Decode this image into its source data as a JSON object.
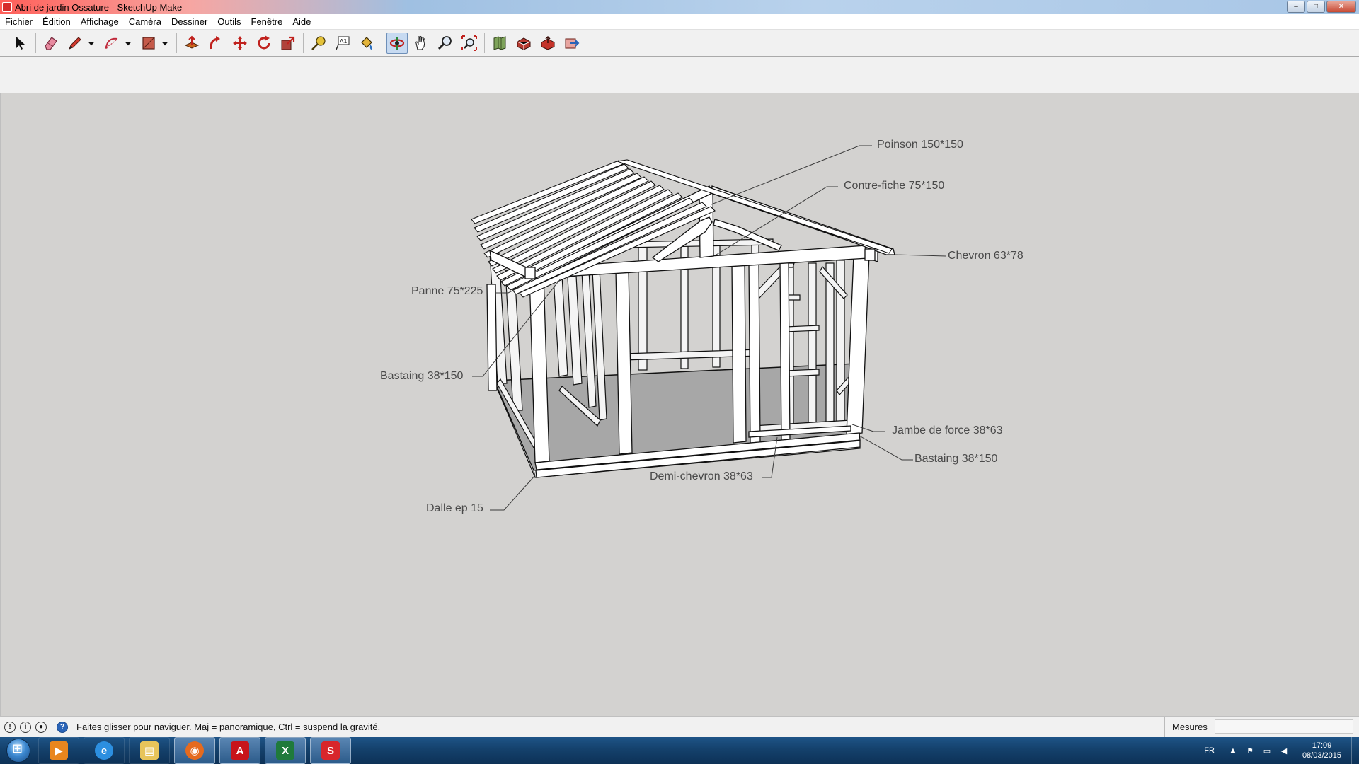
{
  "window": {
    "title": "Abri de jardin Ossature - SketchUp Make",
    "controls": {
      "minimize": "–",
      "maximize": "□",
      "close": "✕"
    }
  },
  "menu": [
    "Fichier",
    "Édition",
    "Affichage",
    "Caméra",
    "Dessiner",
    "Outils",
    "Fenêtre",
    "Aide"
  ],
  "toolbar": {
    "tools": [
      {
        "icon": "select-arrow-icon"
      },
      {
        "icon": "eraser-icon"
      },
      {
        "icon": "pencil-line-icon"
      },
      {
        "icon": "arc-icon"
      },
      {
        "icon": "rectangle-icon"
      },
      {
        "icon": "push-pull-icon"
      },
      {
        "icon": "follow-me-icon"
      },
      {
        "icon": "move-icon"
      },
      {
        "icon": "rotate-icon"
      },
      {
        "icon": "scale-icon"
      },
      {
        "icon": "tape-measure-icon"
      },
      {
        "icon": "text-icon"
      },
      {
        "icon": "paint-bucket-icon"
      },
      {
        "icon": "orbit-icon",
        "active": true
      },
      {
        "icon": "pan-icon"
      },
      {
        "icon": "zoom-icon"
      },
      {
        "icon": "zoom-extents-icon"
      },
      {
        "icon": "add-location-icon"
      },
      {
        "icon": "3d-warehouse-icon"
      },
      {
        "icon": "share-model-icon"
      },
      {
        "icon": "extension-warehouse-icon"
      }
    ]
  },
  "viewport": {
    "labels": {
      "poinson": "Poinson 150*150",
      "contre_fiche": "Contre-fiche 75*150",
      "chevron": "Chevron 63*78",
      "panne": "Panne 75*225",
      "bastaing_left": "Bastaing 38*150",
      "jambe_de_force": "Jambe de force 38*63",
      "bastaing_right": "Bastaing 38*150",
      "demi_chevron": "Demi-chevron 38*63",
      "dalle": "Dalle ep 15"
    }
  },
  "statusbar": {
    "hint": "Faites glisser pour naviguer. Maj = panoramique, Ctrl =  suspend la gravité.",
    "measure_label": "Mesures",
    "measure_value": ""
  },
  "taskbar": {
    "apps": [
      {
        "icon": "media-player-icon",
        "color": "#e8861e"
      },
      {
        "icon": "internet-explorer-icon",
        "color": "#2c8fe0"
      },
      {
        "icon": "file-explorer-icon",
        "color": "#e7c45a"
      },
      {
        "icon": "firefox-icon",
        "color": "#e56a1e"
      },
      {
        "icon": "acrobat-reader-icon",
        "color": "#c8141a"
      },
      {
        "icon": "excel-icon",
        "color": "#1f7a3b"
      },
      {
        "icon": "sketchup-icon",
        "color": "#d8262b"
      }
    ],
    "language": "FR",
    "time": "17:09",
    "date": "08/03/2015"
  }
}
